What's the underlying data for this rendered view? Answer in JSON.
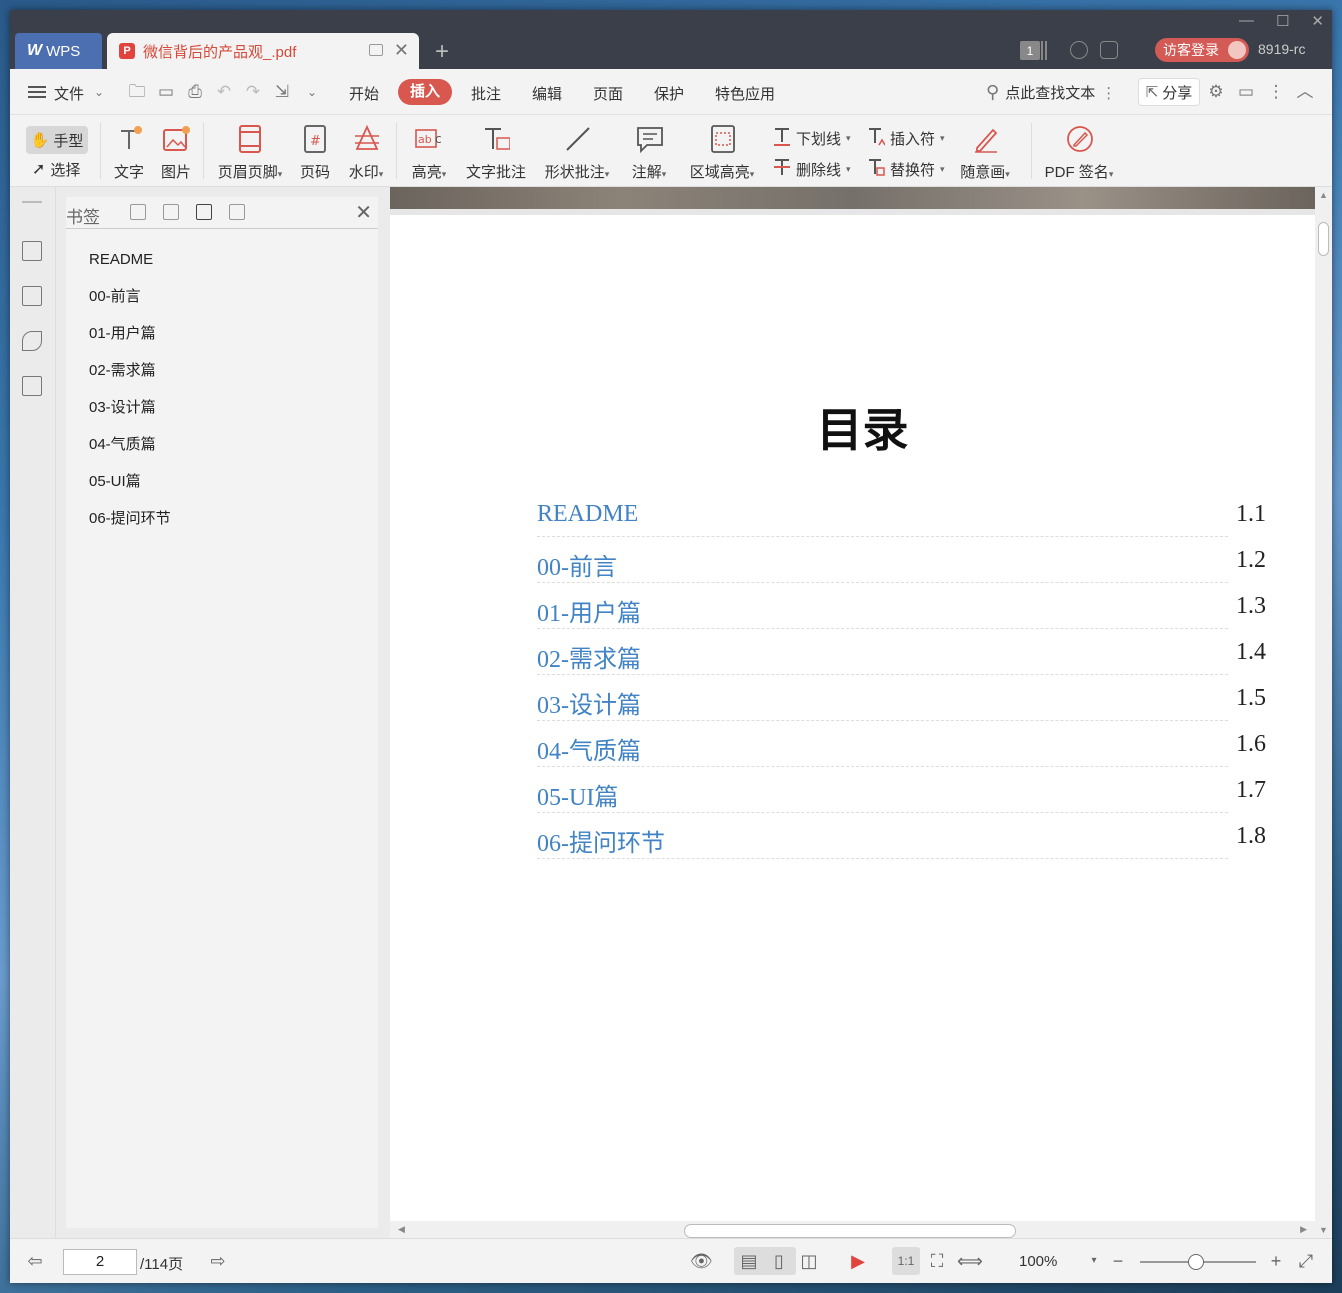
{
  "titlebar": {
    "app_label": "WPS",
    "doc_tab_title": "微信背后的产品观_.pdf",
    "page_count_badge": "1",
    "login_label": "访客登录",
    "user_id": "8919-rc",
    "window_controls": [
      "minimize-icon",
      "maximize-icon",
      "close-icon"
    ]
  },
  "menubar": {
    "file_label": "文件",
    "tabs": [
      {
        "label": "开始",
        "active": false
      },
      {
        "label": "插入",
        "active": true
      },
      {
        "label": "批注",
        "active": false
      },
      {
        "label": "编辑",
        "active": false
      },
      {
        "label": "页面",
        "active": false
      },
      {
        "label": "保护",
        "active": false
      },
      {
        "label": "特色应用",
        "active": false
      }
    ],
    "search_label": "点此查找文本",
    "share_label": "分享",
    "active_color": "#d8584f"
  },
  "ribbon": {
    "hand_label": "手型",
    "select_label": "选择",
    "text_label": "文字",
    "image_label": "图片",
    "header_footer_label": "页眉页脚",
    "page_number_label": "页码",
    "watermark_label": "水印",
    "highlight_label": "高亮",
    "text_comment_label": "文字批注",
    "shape_comment_label": "形状批注",
    "annotation_label": "注解",
    "area_highlight_label": "区域高亮",
    "underline_label": "下划线",
    "strikethrough_label": "删除线",
    "insert_char_label": "插入符",
    "replace_char_label": "替换符",
    "freehand_label": "随意画",
    "pdf_sign_label": "PDF 签名"
  },
  "bookmarks": {
    "title": "书签",
    "items": [
      "README",
      "00-前言",
      "01-用户篇",
      "02-需求篇",
      "03-设计篇",
      "04-气质篇",
      "05-UI篇",
      "06-提问环节"
    ]
  },
  "document": {
    "toc_title": "目录",
    "link_color": "#4183c4",
    "toc": [
      {
        "title": "README",
        "num": "1.1"
      },
      {
        "title": "00-前言",
        "num": "1.2"
      },
      {
        "title": "01-用户篇",
        "num": "1.3"
      },
      {
        "title": "02-需求篇",
        "num": "1.4"
      },
      {
        "title": "03-设计篇",
        "num": "1.5"
      },
      {
        "title": "04-气质篇",
        "num": "1.6"
      },
      {
        "title": "05-UI篇",
        "num": "1.7"
      },
      {
        "title": "06-提问环节",
        "num": "1.8"
      }
    ]
  },
  "statusbar": {
    "current_page": "2",
    "total_pages": "/114页",
    "zoom": "100%"
  }
}
